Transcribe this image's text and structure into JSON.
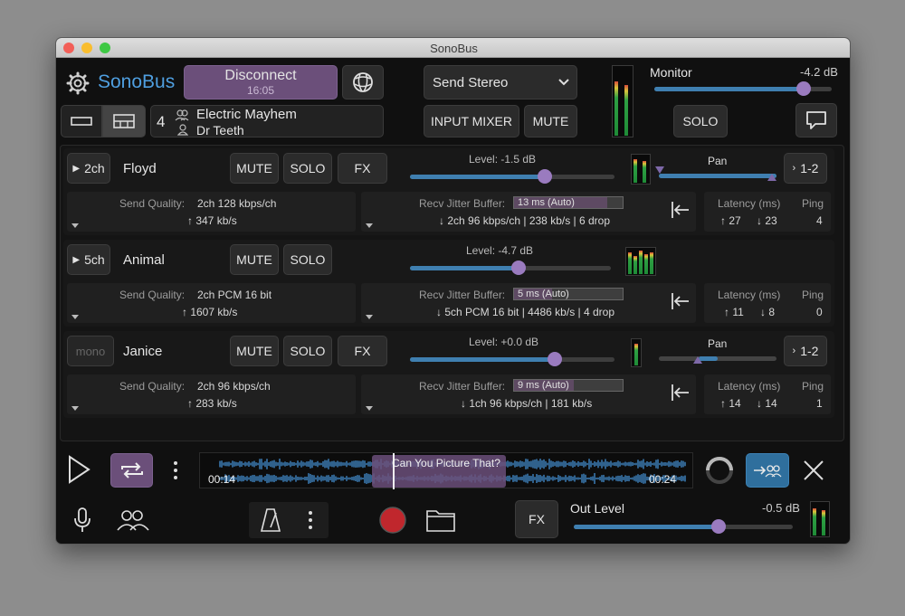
{
  "app": {
    "title": "SonoBus",
    "name": "SonoBus"
  },
  "header": {
    "disconnect_label": "Disconnect",
    "session_time": "16:05",
    "user_count": "4",
    "group_name": "Electric Mayhem",
    "user_name": "Dr Teeth",
    "send_mode": "Send Stereo",
    "input_mixer_label": "INPUT MIXER",
    "mute_label": "MUTE",
    "solo_label": "SOLO",
    "monitor_label": "Monitor",
    "monitor_value": "-4.2 dB",
    "monitor_level": 0.84
  },
  "peers": [
    {
      "channels": "2ch",
      "name": "Floyd",
      "mute": "MUTE",
      "solo": "SOLO",
      "fx": "FX",
      "level_label": "Level: -1.5 dB",
      "level": 0.66,
      "pan_label": "Pan",
      "output": "1-2",
      "send_quality_label": "Send Quality:",
      "send_quality": "2ch 128 kbps/ch",
      "send_rate": "↑ 347 kb/s",
      "jitter_label": "Recv Jitter Buffer:",
      "jitter_value": "13 ms (Auto)",
      "jitter_fill": 0.86,
      "recv_info": "↓ 2ch 96 kbps/ch | 238 kb/s | 6 drop",
      "latency_label": "Latency (ms)",
      "latency_up": "↑ 27",
      "latency_down": "↓ 23",
      "ping_label": "Ping",
      "ping": "4"
    },
    {
      "channels": "5ch",
      "name": "Animal",
      "mute": "MUTE",
      "solo": "SOLO",
      "level_label": "Level: -4.7 dB",
      "level": 0.54,
      "send_quality_label": "Send Quality:",
      "send_quality": "2ch PCM 16 bit",
      "send_rate": "↑ 1607 kb/s",
      "jitter_label": "Recv Jitter Buffer:",
      "jitter_value": "5 ms (Auto)",
      "jitter_fill": 0.35,
      "recv_info": "↓ 5ch PCM 16 bit | 4486 kb/s | 4 drop",
      "latency_label": "Latency (ms)",
      "latency_up": "↑ 11",
      "latency_down": "↓ 8",
      "ping_label": "Ping",
      "ping": "0"
    },
    {
      "channels": "mono",
      "name": "Janice",
      "mute": "MUTE",
      "solo": "SOLO",
      "fx": "FX",
      "level_label": "Level: +0.0 dB",
      "level": 0.71,
      "pan_label": "Pan",
      "output": "1-2",
      "send_quality_label": "Send Quality:",
      "send_quality": "2ch 96 kbps/ch",
      "send_rate": "↑ 283 kb/s",
      "jitter_label": "Recv Jitter Buffer:",
      "jitter_value": "9 ms (Auto)",
      "jitter_fill": 0.55,
      "recv_info": "↓ 1ch 96 kbps/ch | 181 kb/s",
      "latency_label": "Latency (ms)",
      "latency_up": "↑ 14",
      "latency_down": "↓ 14",
      "ping_label": "Ping",
      "ping": "1"
    }
  ],
  "transport": {
    "file_name": "Can You Picture That?",
    "time_start": "00:14",
    "time_end": "00:24",
    "playhead": 0.39
  },
  "footer": {
    "fx_label": "FX",
    "out_level_label": "Out Level",
    "out_level_value": "-0.5 dB",
    "out_level": 0.66
  },
  "icons": {
    "settings": "gear-icon",
    "globe": "globe-icon",
    "chat": "chat-bubble-icon",
    "play": "play-icon",
    "loop": "loop-icon",
    "mic": "microphone-icon",
    "metronome": "metronome-icon",
    "record": "record-icon",
    "folder": "folder-icon"
  },
  "colors": {
    "accent_blue": "#3f7fb0",
    "accent_purple": "#6b4f7a",
    "brand_text": "#4f9fe0",
    "record": "#c0272d"
  }
}
